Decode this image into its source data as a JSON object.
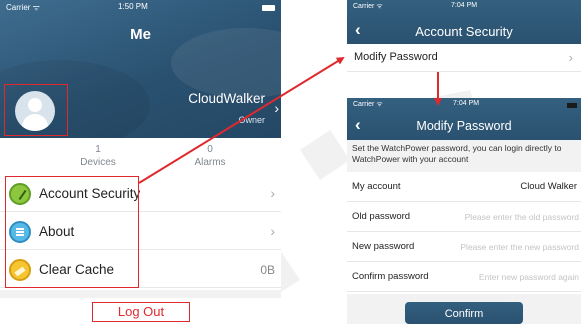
{
  "me_screen": {
    "status_bar": {
      "carrier": "Carrier ᯤ",
      "time": "1:50 PM"
    },
    "title": "Me",
    "user": {
      "name": "CloudWalker",
      "role": "Owner",
      "chevron": "›"
    },
    "stats": [
      {
        "value": "1",
        "label": "Devices"
      },
      {
        "value": "0",
        "label": "Alarms"
      }
    ],
    "menu": [
      {
        "label": "Account Security",
        "icon": "shield-icon",
        "icon_color": "#8dc63f",
        "chevron": "›"
      },
      {
        "label": "About",
        "icon": "document-icon",
        "icon_color": "#57b9e6",
        "chevron": "›"
      },
      {
        "label": "Clear Cache",
        "icon": "broom-icon",
        "icon_color": "#f6c531",
        "value": "0B"
      }
    ],
    "logout_label": "Log Out"
  },
  "account_security_screen": {
    "status_bar": {
      "carrier": "Carrier ᯤ",
      "time": "7:04 PM"
    },
    "back": "‹",
    "title": "Account Security",
    "rows": [
      {
        "label": "Modify Password",
        "chevron": "›"
      }
    ]
  },
  "modify_password_screen": {
    "status_bar": {
      "carrier": "Carrier ᯤ",
      "time": "7:04 PM"
    },
    "back": "‹",
    "title": "Modify Password",
    "description": "Set the WatchPower password, you can login directly to WatchPower with your account",
    "my_account": {
      "label": "My account",
      "value": "Cloud Walker"
    },
    "fields": [
      {
        "label": "Old password",
        "placeholder": "Please enter the old password"
      },
      {
        "label": "New password",
        "placeholder": "Please enter the new password"
      },
      {
        "label": "Confirm password",
        "placeholder": "Enter new password again"
      }
    ],
    "confirm_label": "Confirm"
  },
  "colors": {
    "nav_bar": "#2a5170",
    "highlight": "#e0292d",
    "accent_red": "#e0292d"
  }
}
